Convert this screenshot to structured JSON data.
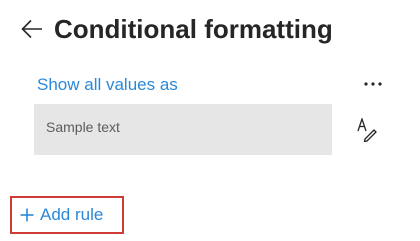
{
  "header": {
    "title": "Conditional formatting",
    "back_icon": "arrow-left-icon"
  },
  "section": {
    "link_label": "Show all values as",
    "more_icon": "ellipsis-icon"
  },
  "sample": {
    "text": "Sample text",
    "format_icon": "text-format-pen-icon"
  },
  "footer": {
    "add_rule_label": "Add rule",
    "add_icon": "plus-icon"
  },
  "colors": {
    "accent": "#2b88d8",
    "highlight_border": "#cf3b36",
    "sample_bg": "#e6e6e6",
    "title": "#262626"
  }
}
